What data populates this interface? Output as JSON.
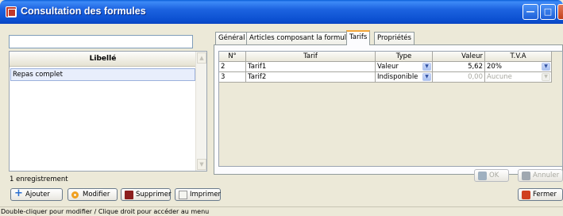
{
  "window": {
    "title": "Consultation des formules",
    "controls": {
      "minimize": "—",
      "maximize": "□",
      "close": "✕"
    }
  },
  "left": {
    "search": {
      "value": "",
      "placeholder": ""
    },
    "list": {
      "header": "Libellé",
      "items": [
        "Repas complet"
      ]
    },
    "count": "1 enregistrement"
  },
  "tabs": [
    {
      "label": "Général",
      "active": false
    },
    {
      "label": "Articles composant la formule",
      "active": false
    },
    {
      "label": "Tarifs",
      "active": true
    },
    {
      "label": "Propriétés",
      "active": false
    }
  ],
  "grid": {
    "columns": [
      "N°",
      "Tarif",
      "Type",
      "Valeur",
      "T.V.A"
    ],
    "rows": [
      {
        "no": "2",
        "tarif": "Tarif1",
        "type": "Valeur",
        "valeur": "5,62",
        "tva": "20%",
        "enabled": true
      },
      {
        "no": "3",
        "tarif": "Tarif2",
        "type": "Indisponible",
        "valeur": "0,00",
        "tva": "Aucune",
        "enabled": false
      }
    ]
  },
  "actions": {
    "ok": "OK",
    "cancel": "Annuler"
  },
  "toolbar": {
    "add": "Ajouter",
    "edit": "Modifier",
    "delete": "Supprimer",
    "print": "Imprimer",
    "close": "Fermer"
  },
  "status": "Double-cliquer pour modifier / Clique droit pour accéder au menu"
}
